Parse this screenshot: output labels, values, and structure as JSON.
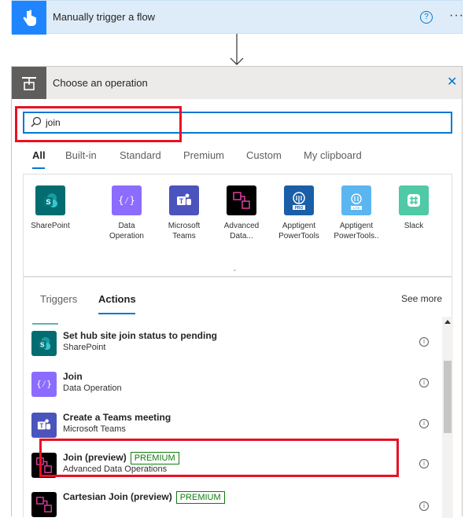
{
  "trigger": {
    "title": "Manually trigger a flow",
    "help_glyph": "?",
    "more_glyph": "···"
  },
  "operation": {
    "title": "Choose an operation",
    "close_glyph": "✕"
  },
  "search": {
    "value": "join",
    "placeholder": ""
  },
  "tabs": [
    "All",
    "Built-in",
    "Standard",
    "Premium",
    "Custom",
    "My clipboard"
  ],
  "active_tab": "All",
  "connectors": [
    {
      "name": "SharePoint",
      "lines": [
        "SharePoint",
        ""
      ],
      "color": "#036c70"
    },
    {
      "name": "Data Operation",
      "lines": [
        "Data",
        "Operation"
      ],
      "color": "#8c6cff"
    },
    {
      "name": "Microsoft Teams",
      "lines": [
        "Microsoft",
        "Teams"
      ],
      "color": "#4b53bc"
    },
    {
      "name": "Advanced Data...",
      "lines": [
        "Advanced",
        "Data..."
      ],
      "color": "#000000"
    },
    {
      "name": "Apptigent PowerTools",
      "lines": [
        "Apptigent",
        "PowerTools"
      ],
      "color": "#1a5ea8"
    },
    {
      "name": "Apptigent PowerTools...",
      "lines": [
        "Apptigent",
        "PowerTools.."
      ],
      "color": "#5bb6f0"
    },
    {
      "name": "Slack",
      "lines": [
        "Slack",
        ""
      ],
      "color": "#4fc9a6"
    }
  ],
  "expand_glyph": "⌄",
  "subtabs": {
    "triggers": "Triggers",
    "actions": "Actions",
    "see_more": "See more"
  },
  "actions": [
    {
      "title": "Set hub site join status to pending",
      "connector": "SharePoint",
      "badge": "",
      "color": "#036c70"
    },
    {
      "title": "Join",
      "connector": "Data Operation",
      "badge": "",
      "color": "#8c6cff"
    },
    {
      "title": "Create a Teams meeting",
      "connector": "Microsoft Teams",
      "badge": "",
      "color": "#4b53bc"
    },
    {
      "title": "Join (preview)",
      "connector": "Advanced Data Operations",
      "badge": "PREMIUM",
      "color": "#000000"
    },
    {
      "title": "Cartesian Join (preview)",
      "connector": "",
      "badge": "PREMIUM",
      "color": "#000000"
    }
  ],
  "info_glyph": "i",
  "colors": {
    "accent": "#0078d4",
    "highlight": "#e81123",
    "premium": "#107c10"
  }
}
